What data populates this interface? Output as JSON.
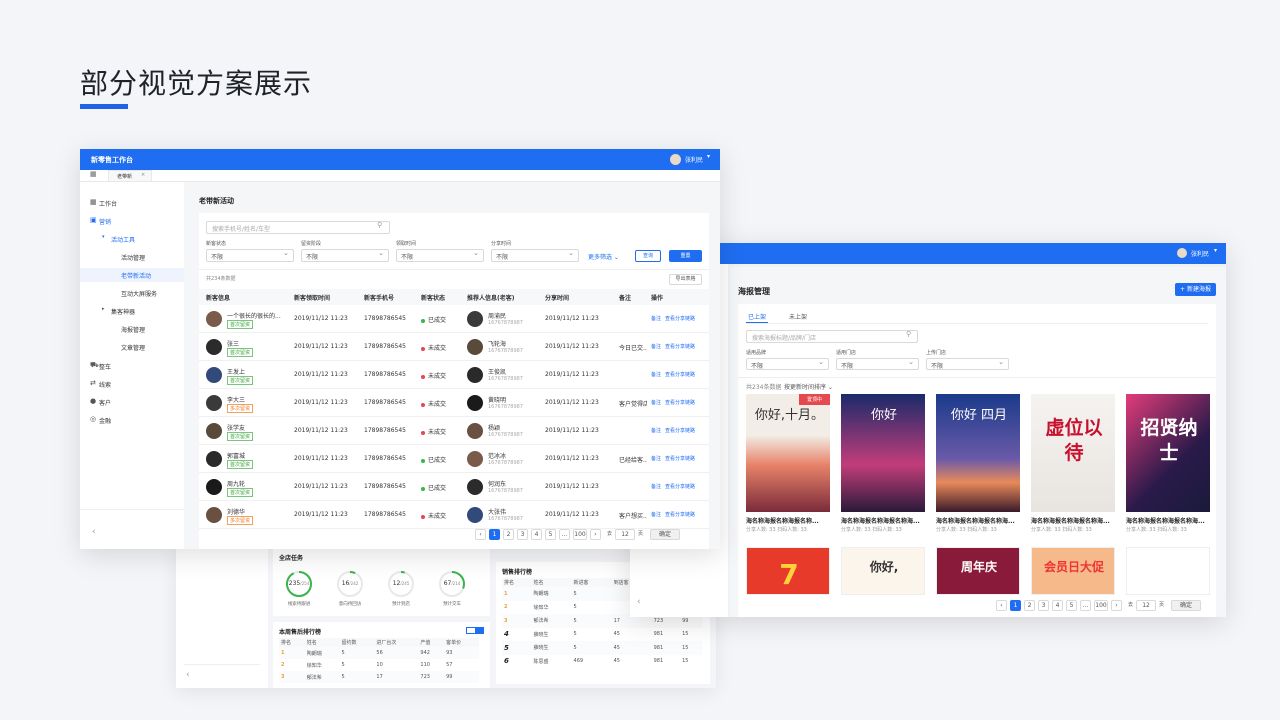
{
  "page_title": "部分视觉方案展示",
  "w1": {
    "app_title": "新零售工作台",
    "user": "张利民",
    "tab": "老带新",
    "nav": [
      {
        "label": "工作台",
        "icon": "grid-icon",
        "level": 0
      },
      {
        "label": "营销",
        "icon": "book-icon",
        "level": 0,
        "active": true
      },
      {
        "label": "活动工具",
        "level": 1,
        "active": true
      },
      {
        "label": "活动管理",
        "level": 2
      },
      {
        "label": "老带新活动",
        "level": 2,
        "selected": true
      },
      {
        "label": "互动大屏服务",
        "level": 2
      },
      {
        "label": "集客神器",
        "level": 1
      },
      {
        "label": "海报管理",
        "level": 2
      },
      {
        "label": "文章管理",
        "level": 2
      },
      {
        "label": "整车",
        "icon": "car-icon",
        "level": 0
      },
      {
        "label": "线索",
        "icon": "flow-icon",
        "level": 0
      },
      {
        "label": "客户",
        "icon": "person-icon",
        "level": 0
      },
      {
        "label": "金融",
        "icon": "coin-icon",
        "level": 0
      }
    ],
    "heading": "老带新活动",
    "search_placeholder": "搜索手机号/姓名/车型",
    "filters": [
      {
        "label": "新客状态",
        "value": "不限"
      },
      {
        "label": "留资阶段",
        "value": "不限"
      },
      {
        "label": "领取时间",
        "value": "不限"
      },
      {
        "label": "分享时间",
        "value": "不限"
      }
    ],
    "more_filter": "更多筛选",
    "query": "查询",
    "reset": "重置",
    "total": "共234条数据",
    "export": "导出表格",
    "columns": [
      "新客信息",
      "新客领取时间",
      "新客手机号",
      "新客状态",
      "推荐人信息(老客)",
      "分享时间",
      "备注",
      "操作"
    ],
    "rows": [
      {
        "name": "一个很长的很长的...",
        "tag": "首次留资",
        "time": "2019/11/12 11:23",
        "phone": "17898786545",
        "status": "已成交",
        "ref": "周渝民",
        "ref_phone": "16767878987",
        "share": "2019/11/12 11:23",
        "note": ""
      },
      {
        "name": "张三",
        "tag": "首次留资",
        "time": "2019/11/12 11:23",
        "phone": "17898786545",
        "status": "未成交",
        "ref": "飞轮海",
        "ref_phone": "16767878987",
        "share": "2019/11/12 11:23",
        "note": "今日已交..."
      },
      {
        "name": "王发上",
        "tag": "首次留资",
        "time": "2019/11/12 11:23",
        "phone": "17898786545",
        "status": "未成交",
        "ref": "王俊凯",
        "ref_phone": "16767878987",
        "share": "2019/11/12 11:23",
        "note": ""
      },
      {
        "name": "李大三",
        "tag": "多次留资",
        "time": "2019/11/12 11:23",
        "phone": "17898786545",
        "status": "未成交",
        "ref": "黄晓明",
        "ref_phone": "16767878987",
        "share": "2019/11/12 11:23",
        "note": "客户觉得店..."
      },
      {
        "name": "张学友",
        "tag": "首次留资",
        "time": "2019/11/12 11:23",
        "phone": "17898786545",
        "status": "未成交",
        "ref": "杨颖",
        "ref_phone": "16767878987",
        "share": "2019/11/12 11:23",
        "note": ""
      },
      {
        "name": "郭富城",
        "tag": "首次留资",
        "time": "2019/11/12 11:23",
        "phone": "17898786545",
        "status": "已成交",
        "ref": "范冰冰",
        "ref_phone": "16767878987",
        "share": "2019/11/12 11:23",
        "note": "已经给客..."
      },
      {
        "name": "周九轮",
        "tag": "首次留资",
        "time": "2019/11/12 11:23",
        "phone": "17898786545",
        "status": "已成交",
        "ref": "何润东",
        "ref_phone": "16767878987",
        "share": "2019/11/12 11:23",
        "note": ""
      },
      {
        "name": "刘德华",
        "tag": "多次留资",
        "time": "2019/11/12 11:23",
        "phone": "17898786545",
        "status": "未成交",
        "ref": "大张伟",
        "ref_phone": "16767878987",
        "share": "2019/11/12 11:23",
        "note": "客户想买..."
      }
    ],
    "op_note": "备注",
    "op_view": "查看分享链路",
    "pages": [
      "1",
      "2",
      "3",
      "4",
      "5",
      "...",
      "100"
    ],
    "goto": "去",
    "goto_val": "12",
    "page_unit": "页",
    "confirm": "确定"
  },
  "w2": {
    "user": "张利民",
    "heading": "海报管理",
    "new_btn": "新建海报",
    "tabs": [
      "已上架",
      "未上架"
    ],
    "search_placeholder": "搜索海报标题/品牌/门店",
    "filters": [
      {
        "label": "适用品牌",
        "value": "不限"
      },
      {
        "label": "适用门店",
        "value": "不限"
      },
      {
        "label": "上传门店",
        "value": "不限"
      }
    ],
    "total": "共234条数据",
    "sort": "按更新时间排序",
    "posters": [
      {
        "title": "海名称海报名称海报名称...",
        "stats": "分享人数: 33    扫码人数: 33",
        "badge": "置顶中",
        "text": "你好,十月。"
      },
      {
        "title": "海名称海报名称海报名称海...",
        "stats": "分享人数: 33    扫码人数: 33",
        "text": "你好"
      },
      {
        "title": "海名称海报名称海报名称海...",
        "stats": "分享人数: 33    扫码人数: 33",
        "text": "你好 四月"
      },
      {
        "title": "海名称海报名称海报名称海...",
        "stats": "分享人数: 33    扫码人数: 33",
        "text": "虚位以待"
      },
      {
        "title": "海名称海报名称海报名称海...",
        "stats": "分享人数: 33    扫码人数: 33",
        "text": "招贤纳士"
      }
    ],
    "posters2": [
      {
        "text": "7"
      },
      {
        "text": "你好,"
      },
      {
        "text": "周年庆"
      },
      {
        "text": "会员日大促"
      },
      {
        "text": ""
      }
    ],
    "pages": [
      "1",
      "2",
      "3",
      "4",
      "5",
      "...",
      "100"
    ],
    "goto": "去",
    "goto_val": "12",
    "page_unit": "页",
    "confirm": "确定"
  },
  "w3": {
    "task_title": "全店任务",
    "gauges": [
      {
        "value": "235",
        "total": "/254",
        "label": "线索待跟进",
        "pct": 0.92
      },
      {
        "value": "16",
        "total": "/242",
        "label": "意向待回访",
        "pct": 0.07
      },
      {
        "value": "12",
        "total": "/245",
        "label": "预计到店",
        "pct": 0.05
      },
      {
        "value": "67",
        "total": "/214",
        "label": "预计交车",
        "pct": 0.31
      }
    ],
    "rank_title": "本周售后排行榜",
    "rank_cols": [
      "排名",
      "姓名",
      "留约数",
      "进厂台次",
      "产值",
      "客单价"
    ],
    "rank_rows": [
      [
        "1",
        "陶朗瑞",
        "5",
        "56",
        "942",
        "93"
      ],
      [
        "2",
        "徐知华",
        "5",
        "10",
        "110",
        "57"
      ],
      [
        "3",
        "郁法希",
        "5",
        "17",
        "723",
        "99"
      ]
    ],
    "sales_title": "销售排行榜",
    "sales_cols": [
      "排名",
      "姓名",
      "新进客",
      "到店客",
      ""
    ],
    "sales_rows": [
      [
        "1",
        "陶朗瑞",
        "5",
        "",
        ""
      ],
      [
        "2",
        "徐知华",
        "5",
        "",
        ""
      ],
      [
        "3",
        "郁法希",
        "5",
        "17",
        "723",
        "99"
      ],
      [
        "4",
        "薛晓生",
        "5",
        "45",
        "981",
        "15"
      ],
      [
        "5",
        "薛晓生",
        "5",
        "45",
        "981",
        "15"
      ],
      [
        "6",
        "陈思盛",
        "469",
        "45",
        "981",
        "15"
      ]
    ]
  }
}
